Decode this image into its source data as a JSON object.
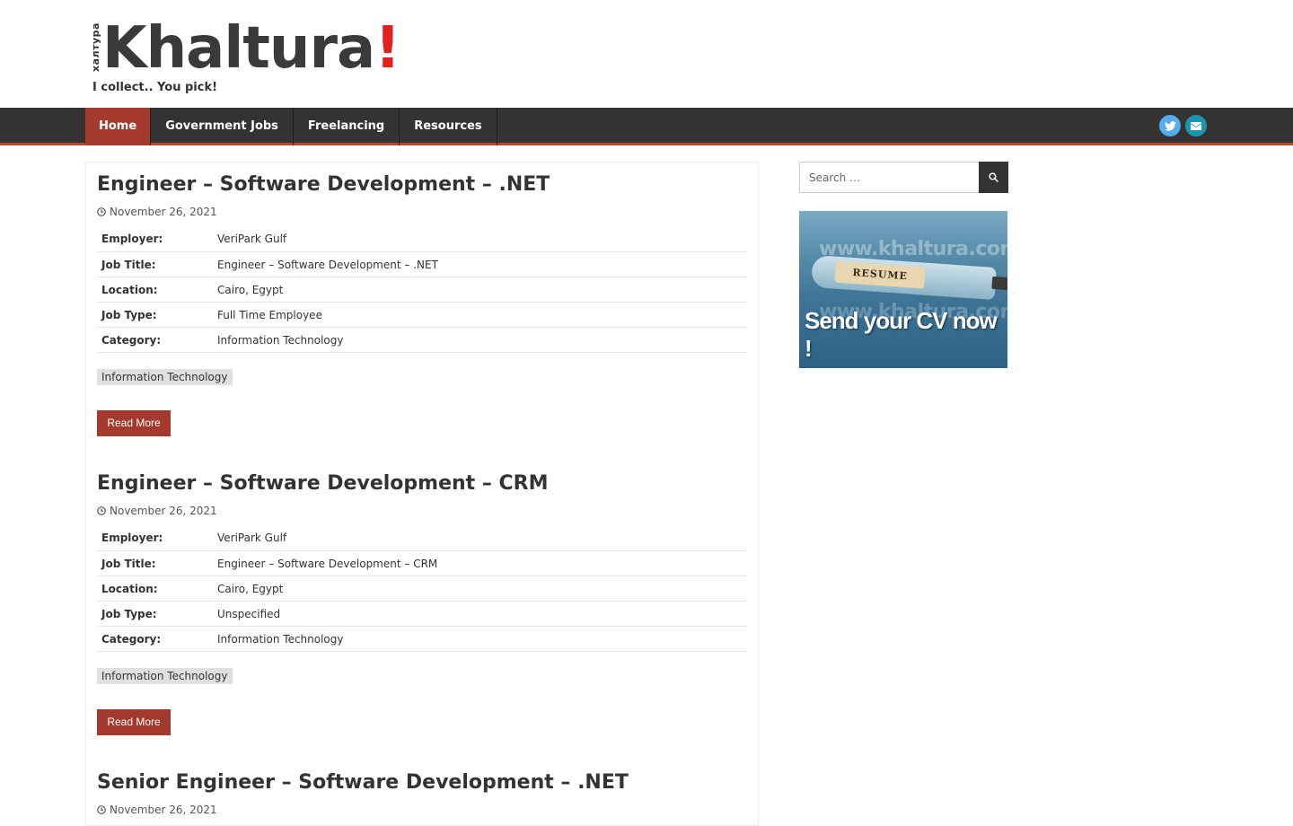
{
  "site": {
    "logo_vertical": "хaлтура",
    "logo_main": "Khaltura",
    "logo_excl": "!",
    "tagline": "I collect.. You pick!"
  },
  "nav": {
    "items": [
      {
        "label": "Home",
        "active": true
      },
      {
        "label": "Government Jobs",
        "active": false
      },
      {
        "label": "Freelancing",
        "active": false
      },
      {
        "label": "Resources",
        "active": false
      }
    ],
    "social": [
      {
        "icon": "twitter-icon",
        "color": "#55acee"
      },
      {
        "icon": "envelope-icon",
        "color": "#1c95b3"
      }
    ]
  },
  "posts": [
    {
      "title": "Engineer – Software Development – .NET",
      "date": "November 26, 2021",
      "fields": [
        {
          "key": "Employer:",
          "value": "VeriPark Gulf"
        },
        {
          "key": "Job Title:",
          "value": "Engineer – Software Development – .NET"
        },
        {
          "key": "Location:",
          "value": "Cairo, Egypt"
        },
        {
          "key": "Job Type:",
          "value": "Full Time Employee"
        },
        {
          "key": "Category:",
          "value": "Information Technology"
        }
      ],
      "tag": "Information Technology",
      "read_more": "Read More"
    },
    {
      "title": "Engineer – Software Development – CRM",
      "date": "November 26, 2021",
      "fields": [
        {
          "key": "Employer:",
          "value": "VeriPark Gulf"
        },
        {
          "key": "Job Title:",
          "value": "Engineer – Software Development – CRM"
        },
        {
          "key": "Location:",
          "value": "Cairo, Egypt"
        },
        {
          "key": "Job Type:",
          "value": "Unspecified"
        },
        {
          "key": "Category:",
          "value": "Information Technology"
        }
      ],
      "tag": "Information Technology",
      "read_more": "Read More"
    },
    {
      "title": "Senior Engineer – Software Development – .NET",
      "date": "November 26, 2021"
    }
  ],
  "sidebar": {
    "search_placeholder": "Search …",
    "ad": {
      "watermark": "www.khaltura.com",
      "paper": "RESUME",
      "text": "Send your CV now !"
    }
  },
  "colors": {
    "accent": "#a33a2d",
    "nav_bg": "#333333",
    "logo_red": "#e1211f"
  }
}
